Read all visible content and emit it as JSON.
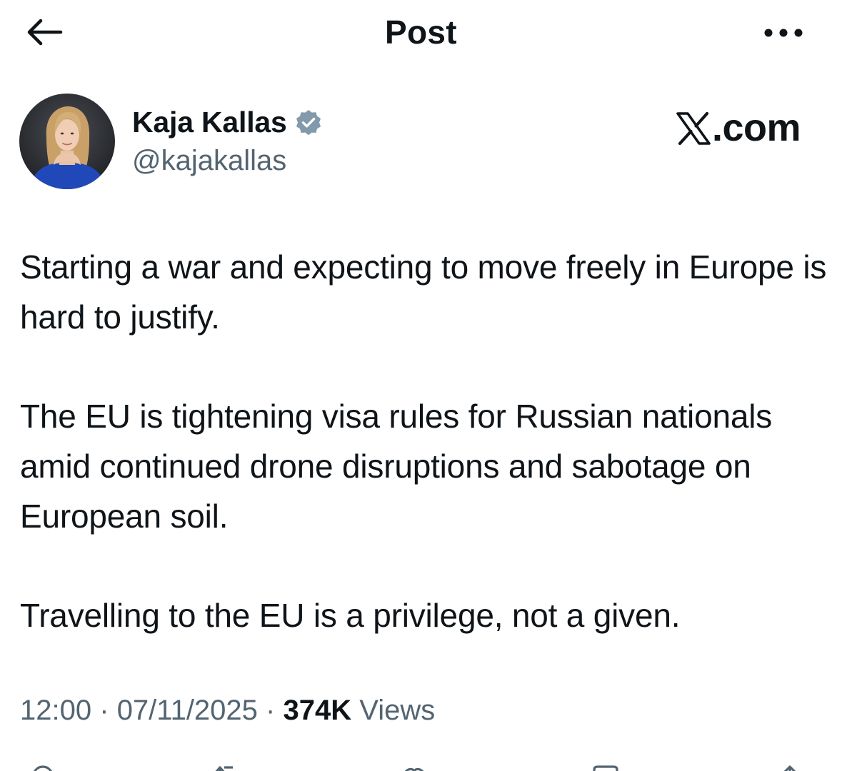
{
  "header": {
    "title": "Post",
    "back_icon": "arrow-left-icon",
    "more_icon": "more-horizontal-icon"
  },
  "author": {
    "name": "Kaja Kallas",
    "handle": "@kajakallas",
    "verified": true,
    "verified_color": "#829aab"
  },
  "watermark": {
    "text": ".com",
    "logo": "x-logo-icon"
  },
  "post": {
    "paragraphs": [
      "Starting a war and expecting to move freely in Europe is hard to justify.",
      "The EU is tightening visa rules for Russian nationals amid continued drone disruptions and sabotage on European soil.",
      "Travelling to the EU is a privilege, not a given."
    ]
  },
  "meta": {
    "time": "12:00",
    "separator": "·",
    "date": "07/11/2025",
    "views_count": "374K",
    "views_label": "Views"
  },
  "actions": [
    {
      "icon": "reply-icon"
    },
    {
      "icon": "repost-icon"
    },
    {
      "icon": "like-icon"
    },
    {
      "icon": "bookmark-icon"
    },
    {
      "icon": "share-icon"
    }
  ],
  "colors": {
    "text": "#0f1419",
    "secondary": "#536471",
    "background": "#ffffff"
  }
}
